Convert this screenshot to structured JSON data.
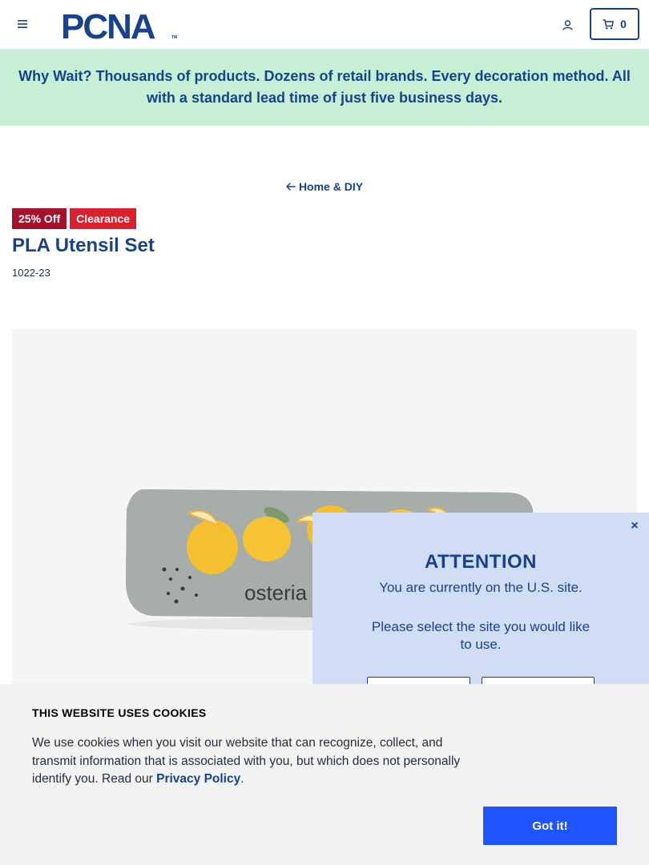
{
  "header": {
    "logo_text": "PCNA",
    "logo_tm": "TM",
    "cart_count": "0"
  },
  "promo": {
    "text": "Why Wait? Thousands of products. Dozens of retail brands. Every decoration method. All with a standard lead time of just five business days."
  },
  "breadcrumb": {
    "label": "Home & DIY"
  },
  "product": {
    "badges": [
      "25% Off",
      "Clearance"
    ],
    "title": "PLA Utensil Set",
    "sku": "1022-23",
    "image_print_text": "osteria"
  },
  "site_modal": {
    "close": "×",
    "title": "ATTENTION",
    "line1": "You are currently on the U.S. site.",
    "line2": "Please select the site you would like to use."
  },
  "cookie_banner": {
    "title": "THIS WEBSITE USES COOKIES",
    "body": "We use cookies when you visit our website that can recognize, collect, and transmit information that is associated with you, but which does not personally identify you. Read our",
    "link": "Privacy Policy",
    "period": ".",
    "button": "Got it!"
  },
  "colors": {
    "brand_blue": "#17428c",
    "promo_bg": "#c6efd5",
    "badge_discount": "#a5122e",
    "badge_clearance": "#d8202f",
    "modal_bg": "#d1ddf4",
    "cookie_button": "#1f55ff"
  },
  "icons": {
    "menu": "hamburger-menu-icon",
    "account": "user-icon",
    "cart": "cart-icon",
    "back": "arrow-left-icon"
  }
}
